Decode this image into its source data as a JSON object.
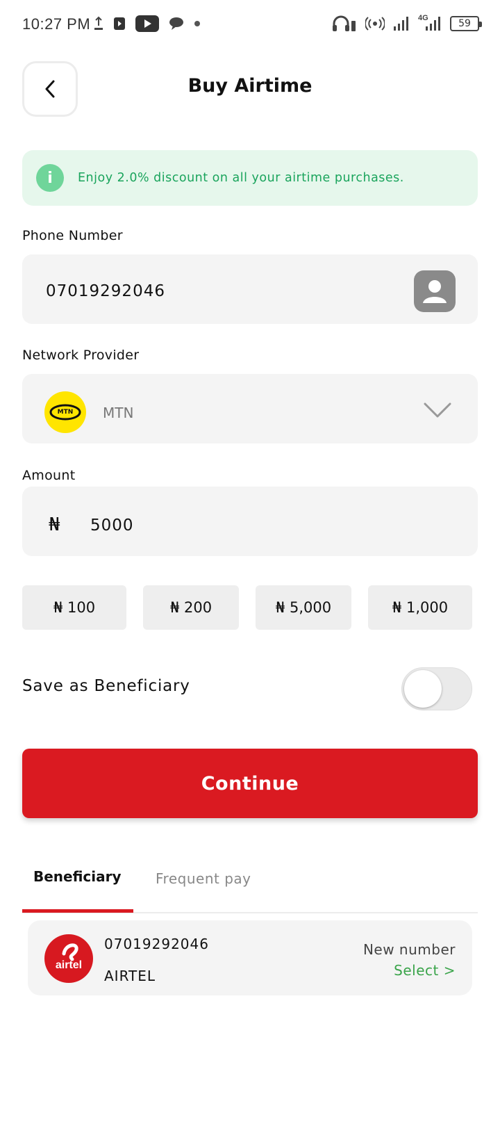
{
  "status_bar": {
    "time": "10:27 PM",
    "battery": "59",
    "network": "4G"
  },
  "header": {
    "title": "Buy Airtime",
    "back_icon": "chevron-left-icon"
  },
  "banner": {
    "text": "Enjoy 2.0% discount on all your airtime purchases.",
    "icon": "info-icon",
    "icon_glyph": "i"
  },
  "phone": {
    "label": "Phone Number",
    "value": "07019292046"
  },
  "provider": {
    "label": "Network Provider",
    "selected": "MTN",
    "logo_text": "MTN"
  },
  "amount": {
    "label": "Amount",
    "currency": "₦",
    "value": "5000"
  },
  "quick_amounts": [
    "₦ 100",
    "₦ 200",
    "₦ 5,000",
    "₦ 1,000"
  ],
  "beneficiary_toggle": {
    "label": "Save as Beneficiary",
    "on": false
  },
  "continue_label": "Continue",
  "tabs": {
    "active": "Beneficiary",
    "inactive": "Frequent pay"
  },
  "beneficiary": {
    "number": "07019292046",
    "network": "AIRTEL",
    "status": "New number",
    "action": "Select >",
    "logo_text": "airtel"
  },
  "colors": {
    "brand_red": "#da1a21",
    "success_green": "#1aa45c",
    "mtn_yellow": "#ffe500"
  }
}
